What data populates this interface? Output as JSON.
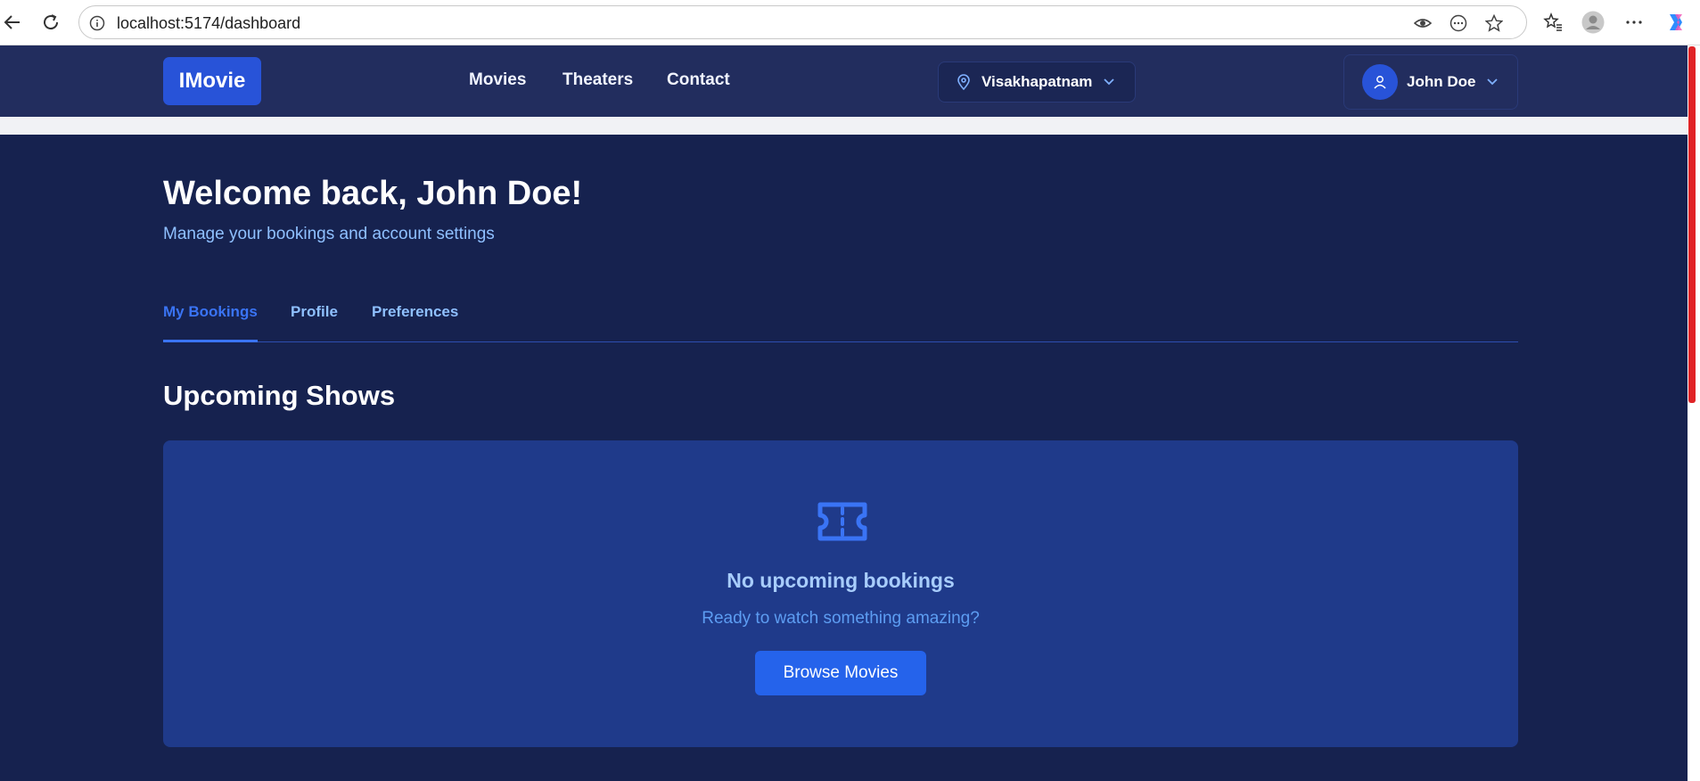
{
  "browser": {
    "url": "localhost:5174/dashboard"
  },
  "site": {
    "logo": "IMovie",
    "nav": [
      "Movies",
      "Theaters",
      "Contact"
    ],
    "city": "Visakhapatnam",
    "user": "John Doe"
  },
  "dashboard": {
    "welcome": "Welcome back, John Doe!",
    "subtitle": "Manage your bookings and account settings",
    "tabs": [
      "My Bookings",
      "Profile",
      "Preferences"
    ],
    "active_tab": "My Bookings",
    "section_title": "Upcoming Shows",
    "empty": {
      "title": "No upcoming bookings",
      "subtitle": "Ready to watch something amazing?",
      "button": "Browse Movies"
    }
  },
  "colors": {
    "navbar": "#222d5e",
    "main_bg": "#16224f",
    "accent": "#2563eb",
    "card": "#1f3a8a",
    "scroll_thumb": "#e02427"
  }
}
